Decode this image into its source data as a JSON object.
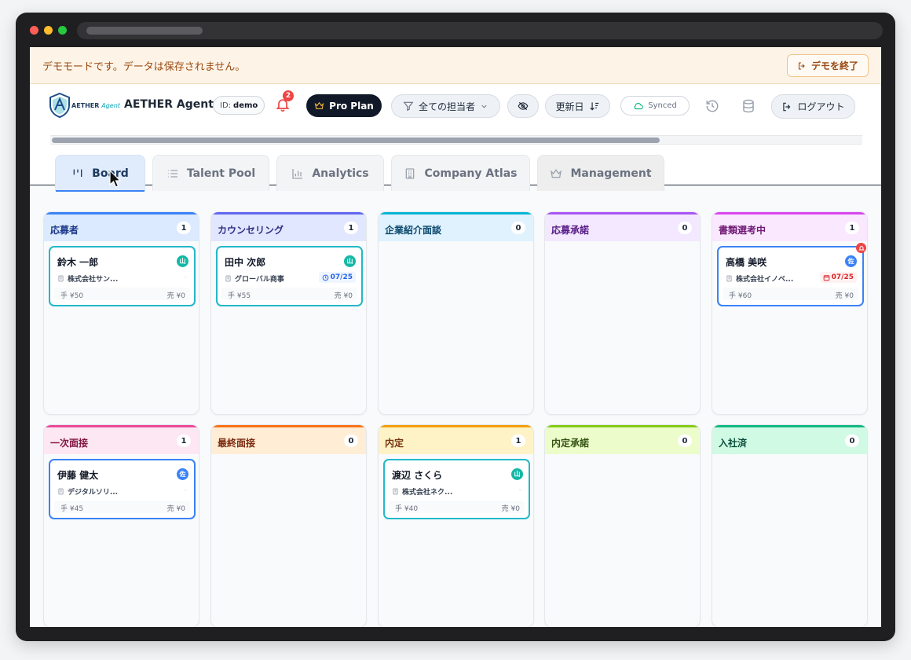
{
  "demo_banner": {
    "text": "デモモードです。データは保存されません。",
    "exit_label": "デモを終了"
  },
  "header": {
    "logo_text": "AETHER",
    "logo_text_suffix": "Agent",
    "app_title": "AETHER Agent",
    "id_label": "ID:",
    "id_value": "demo",
    "notification_count": "2",
    "plan_label": "Pro Plan",
    "assignee_filter": "全ての担当者",
    "sort_label": "更新日",
    "sync_status": "Synced",
    "logout_label": "ログアウト"
  },
  "tabs": [
    {
      "label": "Board",
      "active": true,
      "icon": "board-icon"
    },
    {
      "label": "Talent Pool",
      "active": false,
      "icon": "list-icon"
    },
    {
      "label": "Analytics",
      "active": false,
      "icon": "bar-chart-icon"
    },
    {
      "label": "Company Atlas",
      "active": false,
      "icon": "building-icon"
    },
    {
      "label": "Management",
      "active": false,
      "icon": "crown-icon"
    }
  ],
  "columns": [
    {
      "title": "応募者",
      "count": "1",
      "accent": "#3b82f6",
      "head_bg": "#dbeafe",
      "title_color": "#1e3a8a",
      "card": {
        "name": "鈴木 一郎",
        "tag": "山",
        "company": "株式会社サン...",
        "date": "",
        "fee": "手 ¥50",
        "sales": "売 ¥0"
      }
    },
    {
      "title": "カウンセリング",
      "count": "1",
      "accent": "#6366f1",
      "head_bg": "#e0e7ff",
      "title_color": "#312e81",
      "card": {
        "name": "田中 次郎",
        "tag": "山",
        "company": "グローバル商事",
        "date": "07/25",
        "fee": "手 ¥55",
        "sales": "売 ¥0"
      }
    },
    {
      "title": "企業紹介面談",
      "count": "0",
      "accent": "#06b6d4",
      "head_bg": "#e0f2fe",
      "title_color": "#0c4a6e"
    },
    {
      "title": "応募承諾",
      "count": "0",
      "accent": "#a855f7",
      "head_bg": "#f3e8ff",
      "title_color": "#581c87"
    },
    {
      "title": "書類選考中",
      "count": "1",
      "accent": "#d946ef",
      "head_bg": "#fae8ff",
      "title_color": "#701a75",
      "card": {
        "name": "高橋 美咲",
        "tag": "佐",
        "company": "株式会社イノベ...",
        "date": "07/25",
        "fee": "手 ¥60",
        "sales": "売 ¥0"
      }
    },
    {
      "title": "一次面接",
      "count": "1",
      "accent": "#ec4899",
      "head_bg": "#fce7f3",
      "title_color": "#831843",
      "card": {
        "name": "伊藤 健太",
        "tag": "佐",
        "company": "デジタルソリ...",
        "date": "",
        "fee": "手 ¥45",
        "sales": "売 ¥0"
      }
    },
    {
      "title": "最終面接",
      "count": "0",
      "accent": "#f97316",
      "head_bg": "#ffedd5",
      "title_color": "#7c2d12"
    },
    {
      "title": "内定",
      "count": "1",
      "accent": "#f59e0b",
      "head_bg": "#fef3c7",
      "title_color": "#78350f",
      "card": {
        "name": "渡辺 さくら",
        "tag": "山",
        "company": "株式会社ネク...",
        "date": "",
        "fee": "手 ¥40",
        "sales": "売 ¥0"
      }
    },
    {
      "title": "内定承諾",
      "count": "0",
      "accent": "#84cc16",
      "head_bg": "#ecfccb",
      "title_color": "#365314"
    },
    {
      "title": "入社済",
      "count": "0",
      "accent": "#10b981",
      "head_bg": "#d1fae5",
      "title_color": "#064e3b"
    }
  ]
}
